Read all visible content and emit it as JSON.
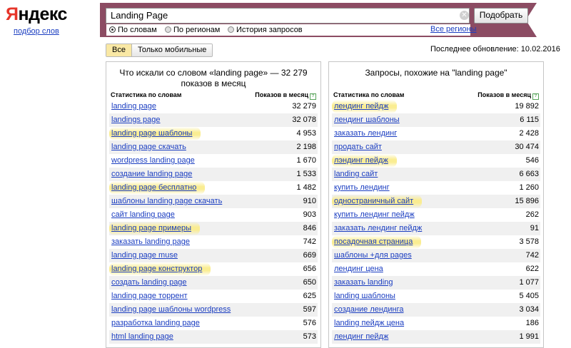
{
  "logo": {
    "first_letter": "Я",
    "rest": "ндекс"
  },
  "sublink": "подбор слов",
  "search": {
    "value": "Landing Page",
    "button": "Подобрать"
  },
  "modes": {
    "by_words": "По словам",
    "by_regions": "По регионам",
    "history": "История запросов"
  },
  "regions_link": "Все регионы",
  "filter": {
    "all": "Все",
    "mobile": "Только мобильные"
  },
  "last_update": "Последнее обновление: 10.02.2016",
  "left_panel": {
    "title_line1": "Что искали со словом «landing page» — 32 279",
    "title_line2": "показов в месяц",
    "col_phrase": "Статистика по словам",
    "col_views": "Показов в месяц",
    "rows": [
      {
        "phrase": "landing page",
        "views": "32 279",
        "highlight": false
      },
      {
        "phrase": "landings page",
        "views": "32 078",
        "highlight": false
      },
      {
        "phrase": "landing page шаблоны",
        "views": "4 953",
        "highlight": true
      },
      {
        "phrase": "landing page скачать",
        "views": "2 198",
        "highlight": false
      },
      {
        "phrase": "wordpress landing page",
        "views": "1 670",
        "highlight": false
      },
      {
        "phrase": "создание landing page",
        "views": "1 533",
        "highlight": false
      },
      {
        "phrase": "landing page бесплатно",
        "views": "1 482",
        "highlight": true
      },
      {
        "phrase": "шаблоны landing page скачать",
        "views": "910",
        "highlight": false
      },
      {
        "phrase": "сайт landing page",
        "views": "903",
        "highlight": false
      },
      {
        "phrase": "landing page примеры",
        "views": "846",
        "highlight": true
      },
      {
        "phrase": "заказать landing page",
        "views": "742",
        "highlight": false
      },
      {
        "phrase": "landing page muse",
        "views": "669",
        "highlight": false
      },
      {
        "phrase": "landing page конструктор",
        "views": "656",
        "highlight": true
      },
      {
        "phrase": "создать landing page",
        "views": "650",
        "highlight": false
      },
      {
        "phrase": "landing page торрент",
        "views": "625",
        "highlight": false
      },
      {
        "phrase": "landing page шаблоны wordpress",
        "views": "597",
        "highlight": false
      },
      {
        "phrase": "разработка landing page",
        "views": "576",
        "highlight": false
      },
      {
        "phrase": "html landing page",
        "views": "573",
        "highlight": false
      }
    ]
  },
  "right_panel": {
    "title_line1": "Запросы, похожие на \"landing page\"",
    "col_phrase": "Статистика по словам",
    "col_views": "Показов в месяц",
    "rows": [
      {
        "phrase": "лендинг пейдж",
        "views": "19 892",
        "highlight": true
      },
      {
        "phrase": "лендинг шаблоны",
        "views": "6 115",
        "highlight": false
      },
      {
        "phrase": "заказать лендинг",
        "views": "2 428",
        "highlight": false
      },
      {
        "phrase": "продать сайт",
        "views": "30 474",
        "highlight": false
      },
      {
        "phrase": "лэндинг пейдж",
        "views": "546",
        "highlight": true
      },
      {
        "phrase": "landing сайт",
        "views": "6 663",
        "highlight": false
      },
      {
        "phrase": "купить лендинг",
        "views": "1 260",
        "highlight": false
      },
      {
        "phrase": "одностраничный сайт",
        "views": "15 896",
        "highlight": true
      },
      {
        "phrase": "купить лендинг пейдж",
        "views": "262",
        "highlight": false
      },
      {
        "phrase": "заказать лендинг пейдж",
        "views": "91",
        "highlight": false
      },
      {
        "phrase": "посадочная страница",
        "views": "3 578",
        "highlight": true
      },
      {
        "phrase": "шаблоны +для pages",
        "views": "742",
        "highlight": false
      },
      {
        "phrase": "лендинг цена",
        "views": "622",
        "highlight": false
      },
      {
        "phrase": "заказать landing",
        "views": "1 077",
        "highlight": false
      },
      {
        "phrase": "landing шаблоны",
        "views": "5 405",
        "highlight": false
      },
      {
        "phrase": "создание лендинга",
        "views": "3 034",
        "highlight": false
      },
      {
        "phrase": "landing пейдж цена",
        "views": "186",
        "highlight": false
      },
      {
        "phrase": "лендинг пейдж",
        "views": "1 991",
        "highlight": false
      }
    ]
  },
  "colors": {
    "band": "#8c4c63",
    "link": "#1a3dc1",
    "highlight": "#faec8c",
    "logo_accent": "#e6352a"
  }
}
